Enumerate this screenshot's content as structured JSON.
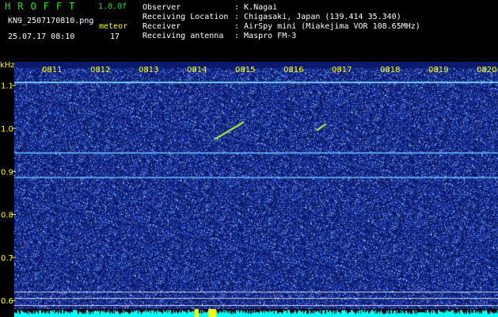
{
  "header": {
    "app_title": "HROFFT",
    "version": "1.0.0f",
    "filename": "KN9_2507170810.png",
    "datetime": "25.07.17 08:10",
    "meteor_label": "meteor",
    "meteor_count": "17",
    "observer_label": "Observer",
    "observer_value": ": K.Nagai",
    "location_label": "Receiving Location",
    "location_value": ": Chigasaki, Japan (139.414 35.340)",
    "receiver_label": "Receiver",
    "receiver_value": ": AirSpy mini (Miakejima VOR 108.65MHz)",
    "antenna_label": "Receiving antenna",
    "antenna_value": ": Maspro FM-3"
  },
  "chart_data": {
    "type": "heatmap",
    "ylabel": "kHz",
    "y_ticks": [
      "1.1",
      "1.0",
      "0.9",
      "0.8",
      "0.7",
      "0.6"
    ],
    "x_ticks": [
      "0811",
      "0812",
      "0813",
      "0814",
      "0815",
      "0816",
      "0817",
      "0818",
      "0819",
      "0820"
    ],
    "ylim": [
      0.58,
      1.14
    ],
    "horizontal_lines_khz": [
      1.109,
      0.944,
      0.887
    ],
    "meteor_traces": [
      {
        "x_start": "0814.4",
        "y_start": 0.975,
        "x_end": "0815.0",
        "y_end": 1.015
      },
      {
        "x_start": "0816.5",
        "y_start": 0.995,
        "x_end": "0816.7",
        "y_end": 1.01
      }
    ],
    "colors": {
      "background": "#0a1a6e",
      "noise": "#3a63d8",
      "line": "#7fd8ff",
      "trace": "#b8ff3a",
      "spectrum": "#00ffff"
    }
  }
}
